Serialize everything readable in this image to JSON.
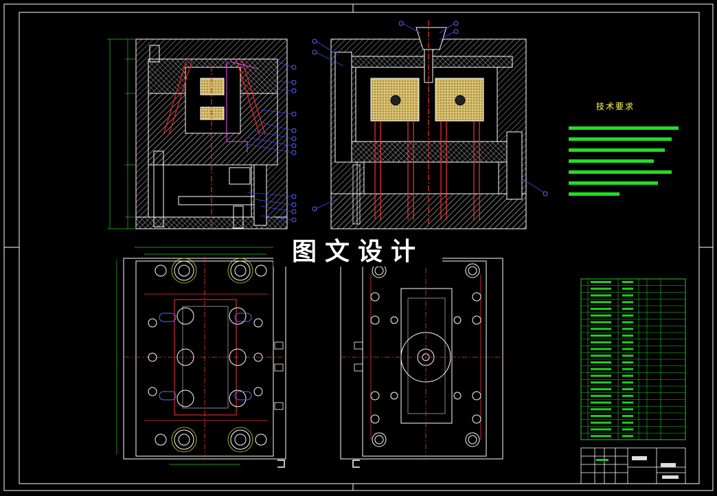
{
  "watermark": "图文设计",
  "tech_requirements": {
    "title": "技术要求"
  }
}
